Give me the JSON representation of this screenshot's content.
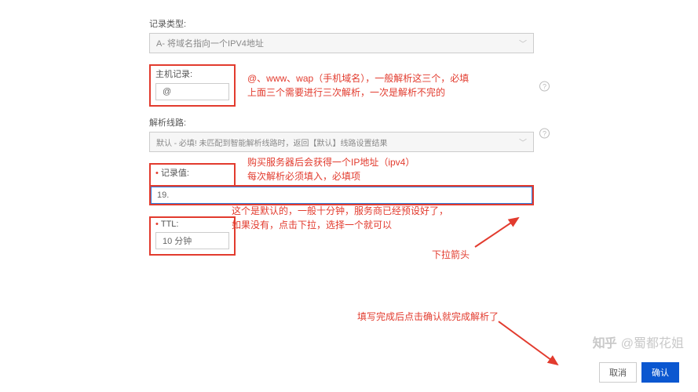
{
  "form": {
    "recordType": {
      "label": "记录类型:",
      "value": "A- 将域名指向一个IPV4地址"
    },
    "hostRecord": {
      "label": "主机记录:",
      "value": "@"
    },
    "resolveLine": {
      "label": "解析线路:",
      "value": "默认 - 必填! 未匹配到智能解析线路时，返回【默认】线路设置结果"
    },
    "recordValue": {
      "label": "记录值:",
      "value": "19."
    },
    "ttl": {
      "label": "TTL:",
      "value": "10 分钟"
    }
  },
  "annotations": {
    "host1": "@、www、wap（手机域名），一般解析这三个，必填",
    "host2": "上面三个需要进行三次解析，一次是解析不完的",
    "value1": "购买服务器后会获得一个IP地址（ipv4）",
    "value2": "每次解析必须填入，必填项",
    "ttl1": "这个是默认的，一般十分钟，服务商已经预设好了，",
    "ttl2": "如果没有，点击下拉，选择一个就可以",
    "dropdownArrow": "下拉箭头",
    "final": "填写完成后点击确认就完成解析了"
  },
  "buttons": {
    "cancel": "取消",
    "confirm": "确认"
  },
  "watermark": {
    "logo": "知乎",
    "author": "@蜀都花姐"
  },
  "icons": {
    "help": "?",
    "chev": "﹀",
    "dot": "•"
  }
}
